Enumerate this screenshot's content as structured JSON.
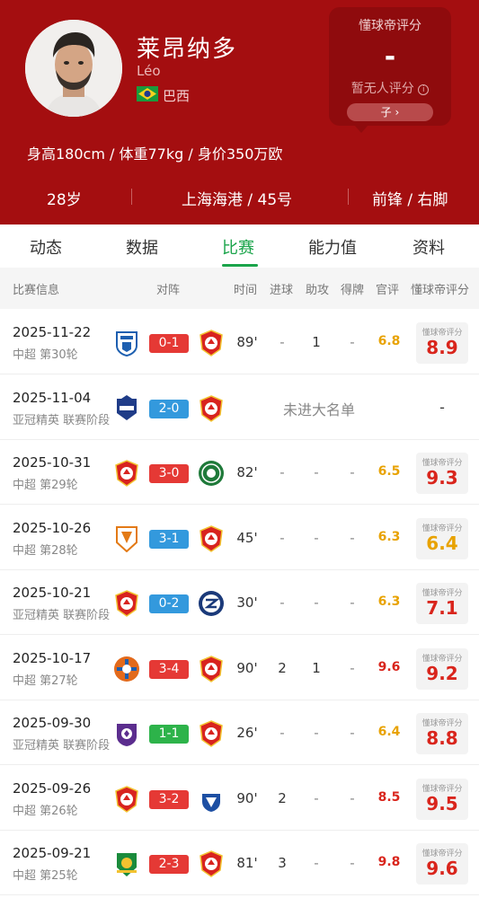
{
  "player": {
    "name_cn": "莱昂纳多",
    "name_en": "Léo",
    "country": "巴西",
    "stats": "身高180cm / 体重77kg / 身价350万欧"
  },
  "rating_card": {
    "title": "懂球帝评分",
    "value": "-",
    "none_text": "暂无人评分",
    "button_text": "子"
  },
  "info_bar": {
    "age": "28岁",
    "club": "上海海港 / 45号",
    "position": "前锋 / 右脚"
  },
  "tabs": [
    "动态",
    "数据",
    "比赛",
    "能力值",
    "资料"
  ],
  "active_tab": 2,
  "columns": {
    "match_info": "比赛信息",
    "lineup": "对阵",
    "time": "时间",
    "goals": "进球",
    "assists": "助攻",
    "cards": "得牌",
    "official": "官评",
    "dcd": "懂球帝评分"
  },
  "dcd_label": "懂球帝评分",
  "matches": [
    {
      "date": "2025-11-22",
      "comp": "中超 第30轮",
      "home_logo": "dalian-logo",
      "away_logo": "shanghai-port-logo",
      "score": "0-1",
      "result": "win",
      "time": "89'",
      "goals": "-",
      "assists": "1",
      "cards": "-",
      "official": "6.8",
      "dcd": "8.9"
    },
    {
      "date": "2025-11-04",
      "comp": "亚冠精英 联赛阶段",
      "home_logo": "buriram-logo",
      "away_logo": "shanghai-port-logo",
      "score": "2-0",
      "result": "draw",
      "dnp": "未进大名单",
      "dcd": "-"
    },
    {
      "date": "2025-10-31",
      "comp": "中超 第29轮",
      "home_logo": "shanghai-port-logo",
      "away_logo": "zhejiang-logo",
      "score": "3-0",
      "result": "win",
      "time": "82'",
      "goals": "-",
      "assists": "-",
      "cards": "-",
      "official": "6.5",
      "dcd": "9.3"
    },
    {
      "date": "2025-10-26",
      "comp": "中超 第28轮",
      "home_logo": "tianjin-logo",
      "away_logo": "shanghai-port-logo",
      "score": "3-1",
      "result": "draw",
      "time": "45'",
      "goals": "-",
      "assists": "-",
      "cards": "-",
      "official": "6.3",
      "dcd": "6.4"
    },
    {
      "date": "2025-10-21",
      "comp": "亚冠精英 联赛阶段",
      "home_logo": "shanghai-port-logo",
      "away_logo": "machida-logo",
      "score": "0-2",
      "result": "draw",
      "time": "30'",
      "goals": "-",
      "assists": "-",
      "cards": "-",
      "official": "6.3",
      "dcd": "7.1"
    },
    {
      "date": "2025-10-17",
      "comp": "中超 第27轮",
      "home_logo": "meizhou-logo",
      "away_logo": "shanghai-port-logo",
      "score": "3-4",
      "result": "win",
      "time": "90'",
      "goals": "2",
      "assists": "1",
      "cards": "-",
      "official": "9.6",
      "dcd": "9.2"
    },
    {
      "date": "2025-09-30",
      "comp": "亚冠精英 联赛阶段",
      "home_logo": "hiroshima-logo",
      "away_logo": "shanghai-port-logo",
      "score": "1-1",
      "result": "draw-green",
      "time": "26'",
      "goals": "-",
      "assists": "-",
      "cards": "-",
      "official": "6.4",
      "dcd": "8.8"
    },
    {
      "date": "2025-09-26",
      "comp": "中超 第26轮",
      "home_logo": "shanghai-port-logo",
      "away_logo": "qingdao-logo",
      "score": "3-2",
      "result": "win",
      "time": "90'",
      "goals": "2",
      "assists": "-",
      "cards": "-",
      "official": "8.5",
      "dcd": "9.5"
    },
    {
      "date": "2025-09-21",
      "comp": "中超 第25轮",
      "home_logo": "beijing-guoan-logo",
      "away_logo": "shanghai-port-logo",
      "score": "2-3",
      "result": "win",
      "time": "81'",
      "goals": "3",
      "assists": "-",
      "cards": "-",
      "official": "9.8",
      "dcd": "9.6"
    }
  ],
  "colors": {
    "header_bg": "#a40e10",
    "accent_green": "#1aa44a",
    "win": "#e53935",
    "draw": "#3399dd",
    "draw_green": "#2db34a",
    "rating_orange": "#e8a200",
    "rating_red": "#d9251c",
    "rating_highlight": "#e8a200"
  }
}
